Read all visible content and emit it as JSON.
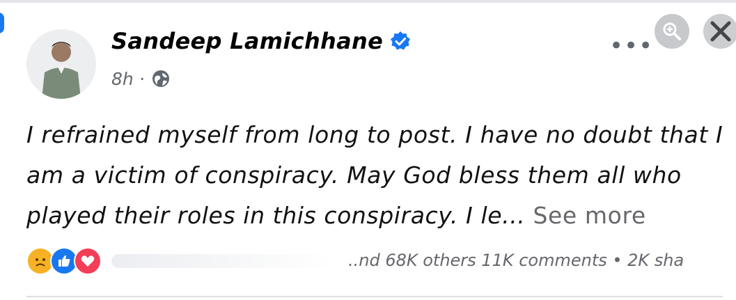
{
  "post": {
    "author": "Sandeep Lamichhane",
    "time": "8h",
    "separator": "·",
    "text": "I refrained myself from long to post. I have no doubt that I am a victim of conspiracy. May God bless them all who played their roles in this conspiracy. I le...",
    "see_more": "See more"
  },
  "engagement": {
    "counts": "..nd 68K others  11K comments • 2K sha"
  },
  "header": {
    "more": "•••"
  },
  "icons": {
    "verified": "verified-badge-icon",
    "privacy": "globe-icon",
    "zoom": "zoom-in-icon",
    "close": "close-icon",
    "reactions": [
      "sad-reaction-icon",
      "like-reaction-icon",
      "love-reaction-icon"
    ]
  },
  "colors": {
    "accent": "#1877f2",
    "secondary_text": "#65676b",
    "love": "#f33e58",
    "sad": "#f7b125"
  }
}
